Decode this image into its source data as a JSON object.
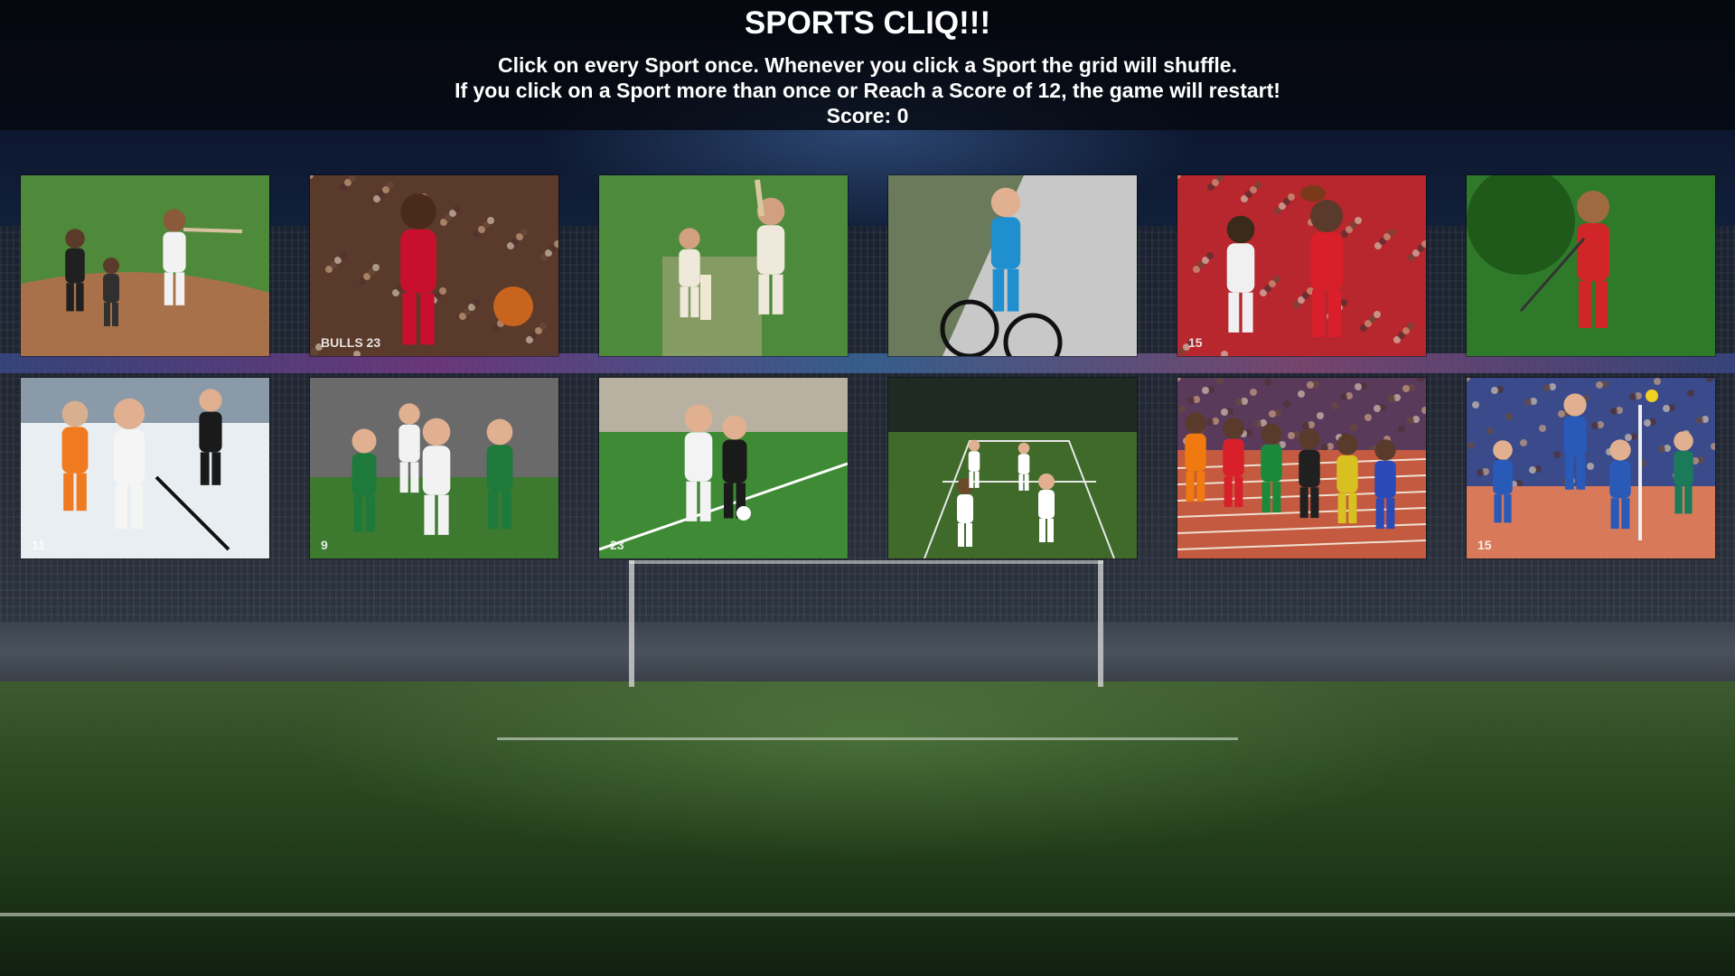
{
  "game": {
    "title": "SPORTS CLIQ!!!",
    "instruction_line1": "Click on every Sport once. Whenever you click a Sport the grid will shuffle.",
    "instruction_line2": "If you click on a Sport more than once or Reach a Score of 12, the game will restart!",
    "score_label": "Score:",
    "score": 0,
    "max_score": 12
  },
  "cards": [
    {
      "sport": "baseball",
      "jersey": "",
      "colors": {
        "ground": "#4f8a3a",
        "dirt": "#a9714a",
        "player": "#f2f2f2"
      }
    },
    {
      "sport": "basketball",
      "jersey": "BULLS 23",
      "colors": {
        "ground": "#5a3a2a",
        "player": "#c8102e"
      }
    },
    {
      "sport": "cricket",
      "jersey": "",
      "colors": {
        "ground": "#4e8a3c",
        "player": "#efe9dc"
      }
    },
    {
      "sport": "cycling",
      "jersey": "",
      "colors": {
        "ground": "#6a7a5a",
        "player": "#1f8fd0"
      }
    },
    {
      "sport": "american-football",
      "jersey": "15",
      "colors": {
        "ground": "#b8262e",
        "player": "#d81f2a"
      }
    },
    {
      "sport": "golf",
      "jersey": "",
      "colors": {
        "ground": "#2f7a2a",
        "player": "#d0262a"
      }
    },
    {
      "sport": "ice-hockey",
      "jersey": "11",
      "colors": {
        "ground": "#e8eef2",
        "player": "#f5f5f5"
      }
    },
    {
      "sport": "rugby",
      "jersey": "9",
      "colors": {
        "ground": "#3d7a30",
        "player": "#1d7a3a"
      }
    },
    {
      "sport": "soccer",
      "jersey": "23",
      "colors": {
        "ground": "#3f8a34",
        "player": "#f3f3f3"
      }
    },
    {
      "sport": "tennis",
      "jersey": "",
      "colors": {
        "ground": "#3f6a2a",
        "player": "#ffffff"
      }
    },
    {
      "sport": "sprinting",
      "jersey": "",
      "colors": {
        "ground": "#c45a40",
        "player": "#f07a10"
      }
    },
    {
      "sport": "volleyball",
      "jersey": "15",
      "colors": {
        "ground": "#d87a5a",
        "player": "#2a5ab8"
      }
    }
  ]
}
